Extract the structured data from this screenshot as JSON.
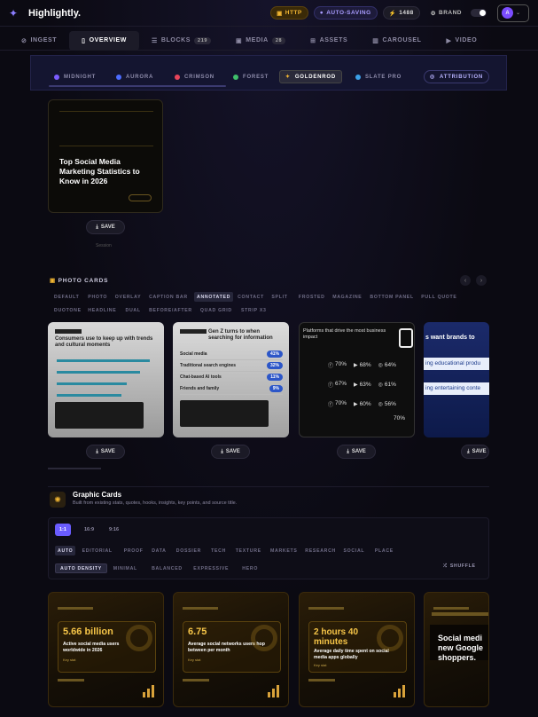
{
  "app": {
    "name": "Highlightly.",
    "http": "HTTP",
    "autosave": "AUTO-SAVING",
    "credits": "1488",
    "brand": "BRAND",
    "avatar": "A"
  },
  "nav": [
    {
      "label": "INGEST"
    },
    {
      "label": "OVERVIEW"
    },
    {
      "label": "BLOCKS",
      "count": "219"
    },
    {
      "label": "MEDIA",
      "count": "28"
    },
    {
      "label": "ASSETS"
    },
    {
      "label": "CAROUSEL"
    },
    {
      "label": "VIDEO"
    }
  ],
  "themes": [
    {
      "label": "MIDNIGHT",
      "color": "#7b5cff"
    },
    {
      "label": "AURORA",
      "color": "#4c6cff"
    },
    {
      "label": "CRIMSON",
      "color": "#e8445a"
    },
    {
      "label": "FOREST",
      "color": "#3fbf6a"
    },
    {
      "label": "GOLDENROD",
      "color": "#f2b632"
    },
    {
      "label": "SLATE PRO",
      "color": "#3ba0e8"
    }
  ],
  "attribution": "ATTRIBUTION",
  "hero": {
    "title": "Top Social Media Marketing Statistics to Know in 2026",
    "save": "SAVE",
    "caption": "Session"
  },
  "photo_cards": {
    "title": "PHOTO CARDS",
    "chips_row1": [
      "DEFAULT",
      "PHOTO",
      "OVERLAY",
      "CAPTION BAR",
      "ANNOTATED",
      "CONTACT",
      "SPLIT",
      "FROSTED",
      "MAGAZINE",
      "BOTTOM PANEL",
      "PULL QUOTE"
    ],
    "chips_row2": [
      "DUOTONE",
      "HEADLINE",
      "DUAL",
      "BEFORE/AFTER",
      "QUAD GRID",
      "STRIP X3"
    ],
    "active": "ANNOTATED",
    "card1_title": "Consumers use to keep up with trends and cultural moments",
    "card2_title": "Gen Z turns to when searching for information",
    "card2_rows": [
      {
        "label": "Social media",
        "value": "41%"
      },
      {
        "label": "Traditional search engines",
        "value": "32%"
      },
      {
        "label": "Chat-based AI tools",
        "value": "11%"
      },
      {
        "label": "Friends and family",
        "value": "9%"
      }
    ],
    "card3_title": "Platforms that drive the most business impact",
    "card3_rows": [
      [
        "70%",
        "68%",
        "64%"
      ],
      [
        "67%",
        "63%",
        "61%"
      ],
      [
        "70%",
        "60%",
        "56%"
      ]
    ],
    "card3_extra": "70%",
    "card4_title": "s want brands to",
    "card4_row1": "ing educational produ",
    "card4_row2": "ing entertaining conte",
    "save": "SAVE"
  },
  "graphic_cards": {
    "title": "Graphic Cards",
    "subtitle": "Built from existing stats, quotes, hooks, insights, key points, and source title.",
    "ratios": [
      "1:1",
      "16:9",
      "9:16"
    ],
    "styles": [
      "AUTO",
      "EDITORIAL",
      "PROOF",
      "DATA",
      "DOSSIER",
      "TECH",
      "TEXTURE",
      "MARKETS",
      "RESEARCH",
      "SOCIAL",
      "PLACE"
    ],
    "density": [
      "AUTO DENSITY",
      "MINIMAL",
      "BALANCED",
      "EXPRESSIVE",
      "HERO"
    ],
    "shuffle": "SHUFFLE",
    "cards": [
      {
        "value": "5.66 billion",
        "desc": "Active social media users worldwide in 2026",
        "tag": "Key stat"
      },
      {
        "value": "6.75",
        "desc": "Average social networks users hop between per month",
        "tag": "Key stat"
      },
      {
        "value": "2 hours 40 minutes",
        "desc": "Average daily time spent on social media apps globally",
        "tag": "Key stat"
      },
      {
        "value": "Social medi new Google shoppers.",
        "desc": "",
        "tag": ""
      }
    ]
  }
}
